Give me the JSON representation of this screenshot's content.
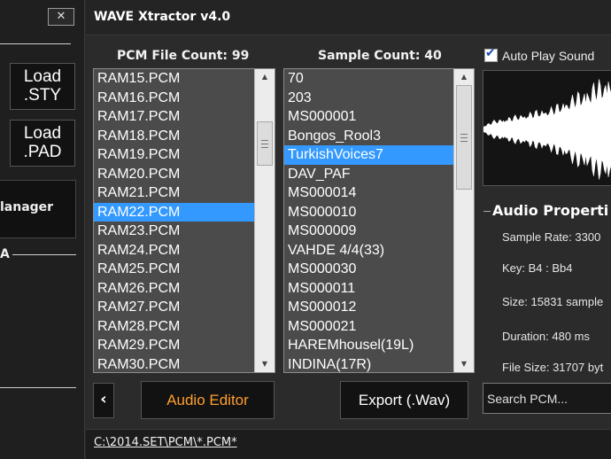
{
  "window": {
    "title": "WAVE Xtractor v4.0",
    "close_glyph": "✕"
  },
  "left_panel": {
    "load_sty_label": "Load\n.STY",
    "load_pad_label": "Load\n.PAD",
    "manager_label": "lanager",
    "section_label": "A"
  },
  "pcm_list": {
    "header": "PCM File Count: 99",
    "selected_index": 7,
    "items": [
      "RAM15.PCM",
      "RAM16.PCM",
      "RAM17.PCM",
      "RAM18.PCM",
      "RAM19.PCM",
      "RAM20.PCM",
      "RAM21.PCM",
      "RAM22.PCM",
      "RAM23.PCM",
      "RAM24.PCM",
      "RAM25.PCM",
      "RAM26.PCM",
      "RAM27.PCM",
      "RAM28.PCM",
      "RAM29.PCM",
      "RAM30.PCM"
    ],
    "scroll_fraction": 0.16
  },
  "sample_list": {
    "header": "Sample Count: 40",
    "selected_index": 4,
    "items": [
      "70",
      "203",
      "MS000001",
      "Bongos_Rool3",
      "TurkishVoices7",
      "DAV_PAF",
      "MS000014",
      "MS000010",
      "MS000009",
      "VAHDE 4/4(33)",
      "MS000030",
      "MS000011",
      "MS000012",
      "MS000021",
      "HAREMhousel(19L)",
      "INDINA(17R)"
    ],
    "scroll_fraction": 0.0
  },
  "right_panel": {
    "auto_play_label": "Auto Play Sound",
    "auto_play_checked": true,
    "group_title": "Audio Properti",
    "properties": {
      "sample_rate": "Sample Rate: 3300",
      "key": "Key:  B4  :  Bb4",
      "size": "Size: 15831 sample",
      "duration": "Duration: 480 ms",
      "file_size": "File Size: 31707 byt"
    }
  },
  "bottom": {
    "nav_glyph": "‹",
    "audio_editor_label": "Audio Editor",
    "export_label": "Export (.Wav)",
    "search_placeholder": "Search PCM...",
    "path": "C:\\2014.SET\\PCM\\*.PCM*"
  },
  "colors": {
    "selection": "#3399ff",
    "accent_orange": "#ff9d2e",
    "list_bg": "#4b4b4b"
  }
}
